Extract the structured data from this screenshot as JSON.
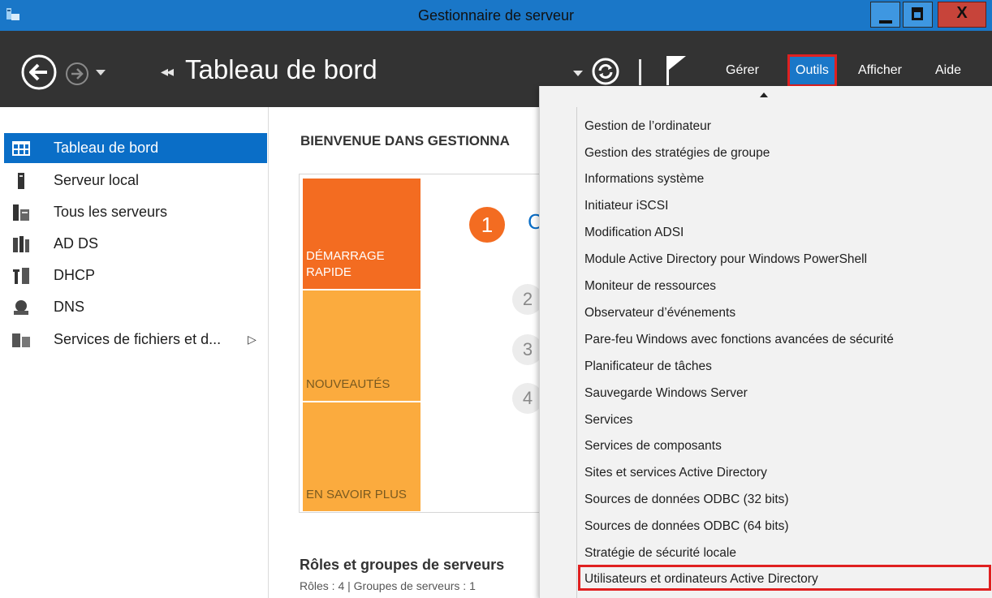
{
  "window": {
    "title": "Gestionnaire de serveur",
    "close_label": "X"
  },
  "header": {
    "breadcrumb_arrows": "◂◂",
    "page_title": "Tableau de bord",
    "menu": [
      "Gérer",
      "Outils",
      "Afficher",
      "Aide"
    ],
    "active_menu": "Outils"
  },
  "sidebar": {
    "items": [
      {
        "label": "Tableau de bord",
        "icon": "dashboard-icon",
        "selected": true
      },
      {
        "label": "Serveur local",
        "icon": "server-icon"
      },
      {
        "label": "Tous les serveurs",
        "icon": "servers-icon"
      },
      {
        "label": "AD DS",
        "icon": "adds-icon"
      },
      {
        "label": "DHCP",
        "icon": "dhcp-icon"
      },
      {
        "label": "DNS",
        "icon": "dns-icon"
      },
      {
        "label": "Services de fichiers et d...",
        "icon": "file-services-icon",
        "expandable": "▷"
      }
    ]
  },
  "main": {
    "welcome_title": "BIENVENUE DANS GESTIONNA",
    "tiles": [
      "DÉMARRAGE\nRAPIDE",
      "NOUVEAUTÉS",
      "EN SAVOIR PLUS"
    ],
    "steps": [
      "1",
      "2",
      "3",
      "4"
    ],
    "step1_partial": "C",
    "roles_title": "Rôles et groupes de serveurs",
    "roles_stats": "Rôles : 4  |  Groupes de serveurs : 1"
  },
  "tools_menu": {
    "items": [
      "Gestion de l’ordinateur",
      "Gestion des stratégies de groupe",
      "Informations système",
      "Initiateur iSCSI",
      "Modification ADSI",
      "Module Active Directory pour Windows PowerShell",
      "Moniteur de ressources",
      "Observateur d’événements",
      "Pare-feu Windows avec fonctions avancées de sécurité",
      "Planificateur de tâches",
      "Sauvegarde Windows Server",
      "Services",
      "Services de composants",
      "Sites et services Active Directory",
      "Sources de données ODBC (32 bits)",
      "Sources de données ODBC (64 bits)",
      "Stratégie de sécurité locale",
      "Utilisateurs et ordinateurs Active Directory"
    ],
    "highlighted": "Utilisateurs et ordinateurs Active Directory"
  },
  "colors": {
    "titlebar": "#1a77c8",
    "header": "#333333",
    "selection": "#0a6ec7",
    "quick_start": "#f36c21",
    "tile_secondary": "#fbab3e",
    "highlight_outline": "#e02020"
  }
}
